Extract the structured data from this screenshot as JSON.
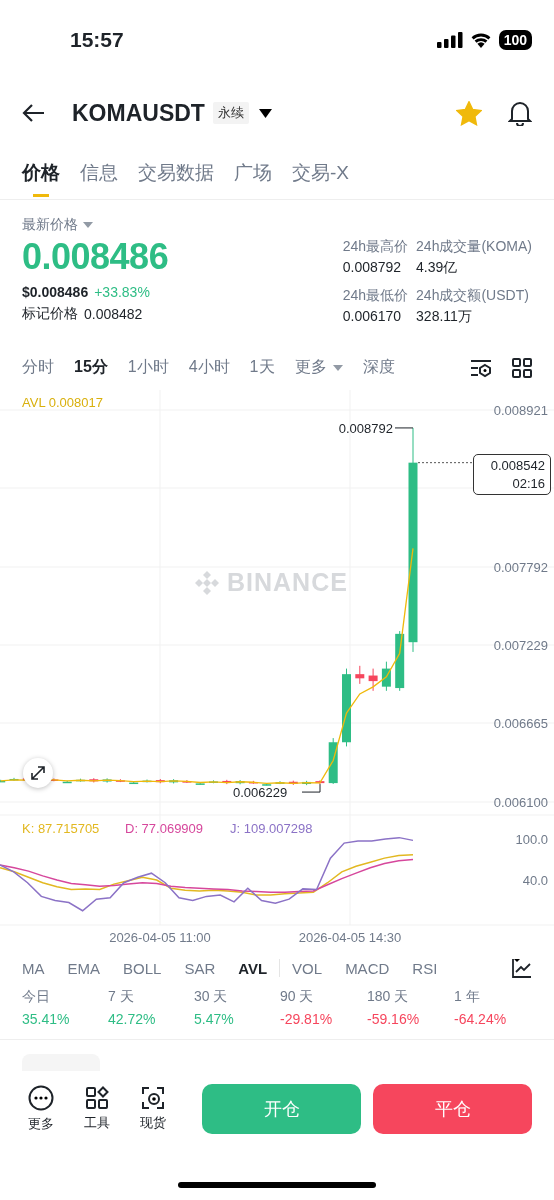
{
  "status_bar": {
    "time": "15:57",
    "battery": "100"
  },
  "header": {
    "symbol": "KOMAUSDT",
    "contract_tag": "永续",
    "favorite": true
  },
  "tabs": [
    {
      "label": "价格",
      "selected": true
    },
    {
      "label": "信息",
      "selected": false
    },
    {
      "label": "交易数据",
      "selected": false
    },
    {
      "label": "广场",
      "selected": false
    },
    {
      "label": "交易-X",
      "selected": false
    }
  ],
  "price": {
    "label": "最新价格",
    "last": "0.008486",
    "usd": "$0.008486",
    "change": "+33.83%",
    "mark_label": "标记价格",
    "mark": "0.008482",
    "stats": [
      {
        "label": "24h最高价",
        "value": "0.008792"
      },
      {
        "label": "24h成交量(KOMA)",
        "value": "4.39亿"
      },
      {
        "label": "24h最低价",
        "value": "0.006170"
      },
      {
        "label": "24h成交额(USDT)",
        "value": "328.11万"
      }
    ]
  },
  "intervals": [
    {
      "label": "分时",
      "kind": "tab",
      "selected": false
    },
    {
      "label": "15分",
      "kind": "tab",
      "selected": true
    },
    {
      "label": "1小时",
      "kind": "tab",
      "selected": false
    },
    {
      "label": "4小时",
      "kind": "tab",
      "selected": false
    },
    {
      "label": "1天",
      "kind": "tab",
      "selected": false
    },
    {
      "label": "更多",
      "kind": "menu",
      "selected": false
    },
    {
      "label": "深度",
      "kind": "tab",
      "selected": false
    }
  ],
  "chart": {
    "avl": "AVL 0.008017",
    "watermark": "BINANCE",
    "y_labels": [
      "0.008921",
      "0.007792",
      "0.007229",
      "0.006665",
      "0.006100"
    ],
    "high_marker": "0.008792",
    "low_marker": "0.006229",
    "last_price": "0.008542",
    "countdown": "02:16",
    "kdj_legend": [
      {
        "text": "K: 87.715705",
        "color": "#e2b821"
      },
      {
        "text": "D: 77.069909",
        "color": "#d6479c"
      },
      {
        "text": "J: 109.007298",
        "color": "#8b72c6"
      }
    ],
    "kdj_labels": [
      "100.0",
      "40.0"
    ],
    "dates": [
      "2026-04-05 11:00",
      "2026-04-05 14:30"
    ]
  },
  "indicators": [
    {
      "label": "MA",
      "selected": false
    },
    {
      "label": "EMA",
      "selected": false
    },
    {
      "label": "BOLL",
      "selected": false
    },
    {
      "label": "SAR",
      "selected": false
    },
    {
      "label": "AVL",
      "selected": true
    },
    {
      "label": "VOL",
      "selected": false
    },
    {
      "label": "MACD",
      "selected": false
    },
    {
      "label": "RSI",
      "selected": false
    }
  ],
  "returns": [
    {
      "period": "今日",
      "value": "35.41%",
      "color": "#2ebd85"
    },
    {
      "period": "7 天",
      "value": "42.72%",
      "color": "#2ebd85"
    },
    {
      "period": "30 天",
      "value": "5.47%",
      "color": "#2ebd85"
    },
    {
      "period": "90 天",
      "value": "-29.81%",
      "color": "#f6465d"
    },
    {
      "period": "180 天",
      "value": "-59.16%",
      "color": "#f6465d"
    },
    {
      "period": "1 年",
      "value": "-64.24%",
      "color": "#f6465d"
    }
  ],
  "bottom_bar": {
    "shortcuts": [
      {
        "label": "更多",
        "kind": "more"
      },
      {
        "label": "工具",
        "kind": "tools"
      },
      {
        "label": "现货",
        "kind": "spot"
      }
    ],
    "open_button": "开仓",
    "close_button": "平仓"
  }
}
